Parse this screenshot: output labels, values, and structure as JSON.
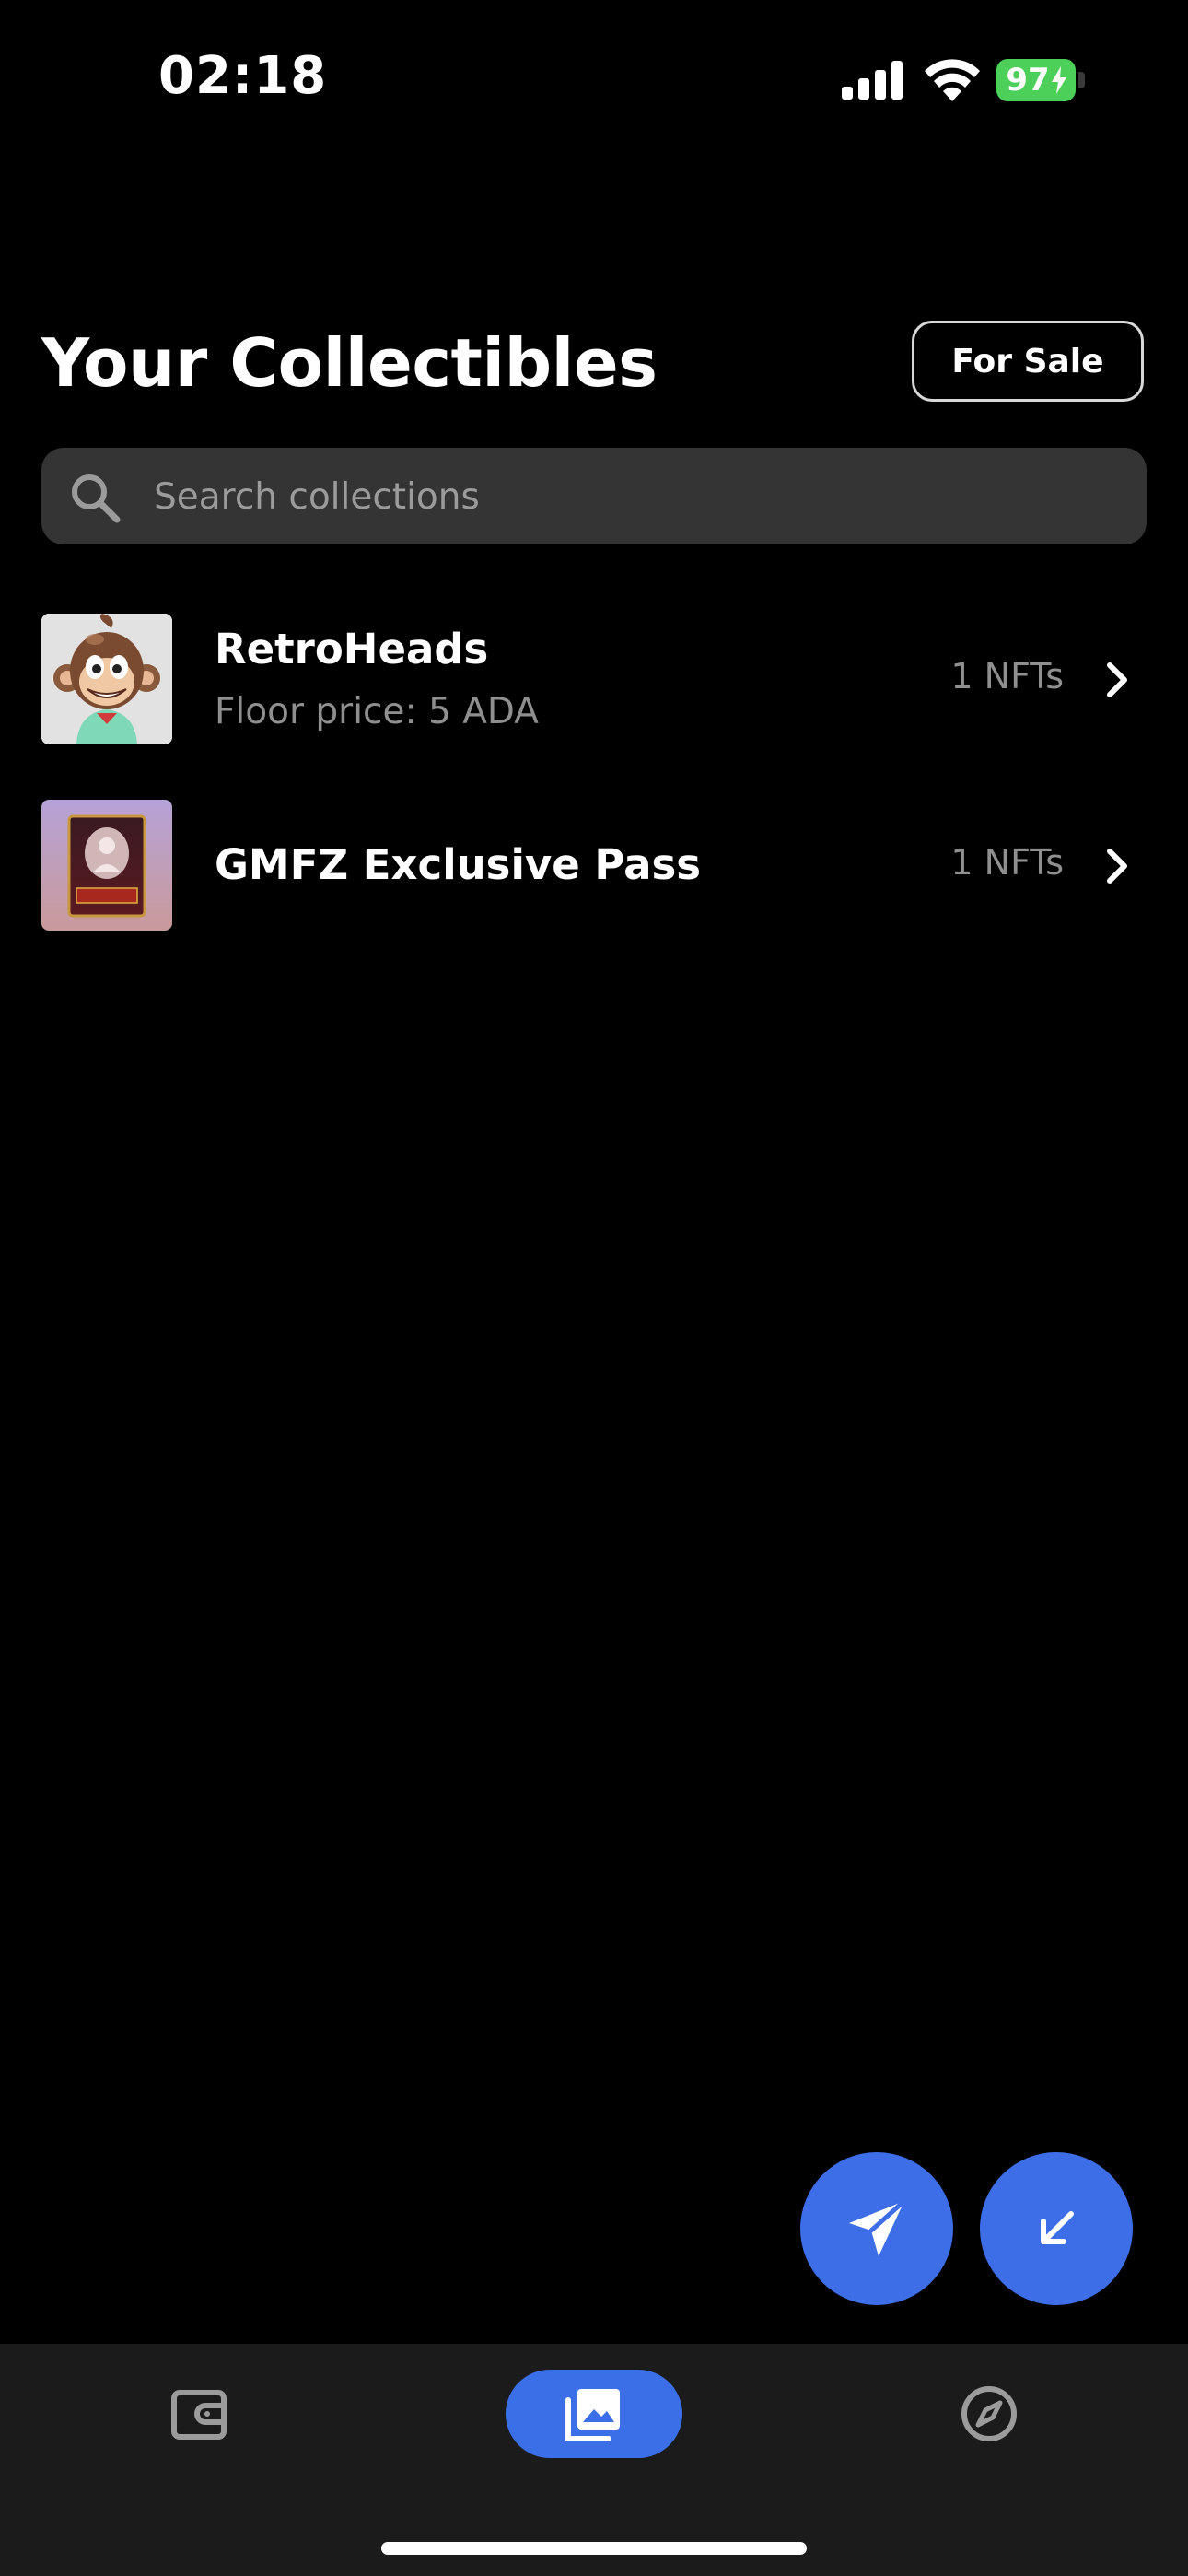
{
  "status_bar": {
    "time": "02:18",
    "battery_level": "97",
    "battery_color": "#4cd05a"
  },
  "header": {
    "title": "Your Collectibles",
    "for_sale_label": "For Sale"
  },
  "search": {
    "placeholder": "Search collections",
    "value": ""
  },
  "collections": [
    {
      "name": "RetroHeads",
      "subtitle": "Floor price: 5 ADA",
      "count": "1 NFTs",
      "thumbnail": "cartoon-monkey-icon"
    },
    {
      "name": "GMFZ Exclusive Pass",
      "subtitle": "",
      "count": "1 NFTs",
      "thumbnail": "exclusive-pass-card-icon"
    }
  ],
  "actions": {
    "send_icon": "paper-plane-icon",
    "receive_icon": "arrow-down-left-icon",
    "accent_color": "#3d6ee8"
  },
  "bottom_nav": {
    "items": [
      {
        "name": "wallet",
        "icon": "wallet-icon",
        "active": false
      },
      {
        "name": "collectibles",
        "icon": "gallery-icon",
        "active": true
      },
      {
        "name": "discover",
        "icon": "compass-icon",
        "active": false
      }
    ]
  }
}
